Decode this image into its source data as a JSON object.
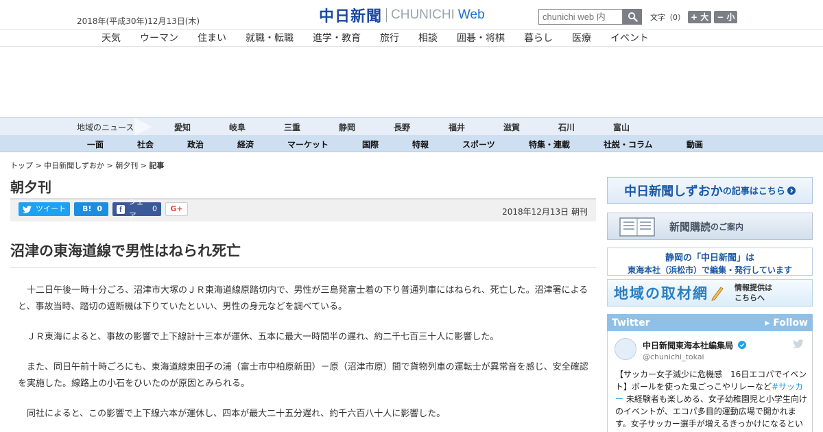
{
  "header": {
    "date": "2018年(平成30年)12月13日(木)",
    "logo_ja": "中日新聞",
    "logo_en": "CHUNICHI",
    "logo_web": "Web",
    "search_placeholder": "chunichi web 内",
    "textsize_label": "文字（0）",
    "textsize_larger": "+ 大",
    "textsize_smaller": "− 小"
  },
  "nav_top": [
    "天気",
    "ウーマン",
    "住まい",
    "就職・転職",
    "進学・教育",
    "旅行",
    "相談",
    "囲碁・将棋",
    "暮らし",
    "医療",
    "イベント"
  ],
  "region": {
    "label": "地域のニュース",
    "items": [
      "愛知",
      "岐阜",
      "三重",
      "静岡",
      "長野",
      "福井",
      "滋賀",
      "石川",
      "富山"
    ]
  },
  "categories": [
    "一面",
    "社会",
    "政治",
    "経済",
    "マーケット",
    "国際",
    "特報",
    "スポーツ",
    "特集・連載",
    "社説・コラム",
    "動画"
  ],
  "breadcrumb": [
    "トップ",
    "中日新聞しずおか",
    "朝夕刊",
    "記事"
  ],
  "section_title": "朝夕刊",
  "share": {
    "tweet": "ツイート",
    "hatena_label": "B!",
    "hatena_count": "0",
    "facebook": "シェア",
    "facebook_count": "0",
    "gplus": "G+"
  },
  "article": {
    "date": "2018年12月13日 朝刊",
    "headline": "沼津の東海道線で男性はねられ死亡",
    "paragraphs": [
      "十二日午後一時十分ごろ、沼津市大塚のＪＲ東海道線原踏切内で、男性が三島発富士着の下り普通列車にはねられ、死亡した。沼津署によると、事故当時、踏切の遮断機は下りていたといい、男性の身元などを調べている。",
      "ＪＲ東海によると、事故の影響で上下線計十三本が運休、五本に最大一時間半の遅れ、約二千七百三十人に影響した。",
      "また、同日午前十時ごろにも、東海道線東田子の浦（富士市中柏原新田）－原（沼津市原）間で貨物列車の運転士が異常音を感じ、安全確認を実施した。線路上の小石をひいたのが原因とみられる。",
      "同社によると、この影響で上下線六本が運休し、四本が最大二十五分遅れ、約千六百八十人に影響した。"
    ]
  },
  "sidebar": {
    "banner1_big": "中日新聞しずおか",
    "banner1_small": "の記事はこちら",
    "banner2_big": "新聞購読",
    "banner2_small": "のご案内",
    "banner3_line1": "静岡の「中日新聞」は",
    "banner3_line2": "東海本社（浜松市）で編集・発行しています",
    "banner4_big": "地域の取材網",
    "banner4_small1": "情報提供は",
    "banner4_small2": "こちらへ",
    "twitter_title": "Twitter",
    "twitter_follow": "▸ Follow",
    "tweet_name": "中日新聞東海本社編集局",
    "tweet_handle": "@chunichi_tokai",
    "tweet_text_1": "【サッカー女子減少に危機感　16日エコパでイベント】ボールを使った鬼ごっこやリレーなど",
    "tweet_tag": "#サッカー",
    "tweet_text_2": " 未経験者も楽しめる、女子幼稚園児と小学生向けのイベントが、エコパ多目的運動広場で開かれます。女子サッカー選手が増えるきっかけになるとい"
  },
  "colors": {
    "brand_blue": "#1a4aa0",
    "region_bar": "#e7eef7",
    "category_bar": "#cfdff2",
    "twitter_header": "#8fc1e8"
  }
}
